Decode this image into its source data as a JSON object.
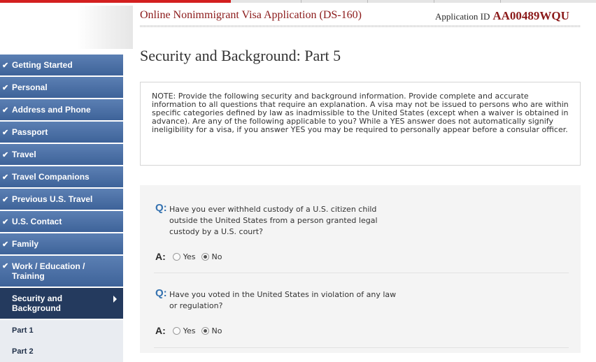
{
  "header": {
    "app_title": "Online Nonimmigrant Visa Application (DS-160)",
    "app_id_label": "Application ID",
    "app_id_value": "AA00489WQU"
  },
  "page": {
    "title": "Security and Background: Part 5"
  },
  "sidebar": {
    "items": [
      {
        "label": "Getting Started",
        "check": "✔"
      },
      {
        "label": "Personal",
        "check": "✔"
      },
      {
        "label": "Address and Phone",
        "check": "✔"
      },
      {
        "label": "Passport",
        "check": "✔"
      },
      {
        "label": "Travel",
        "check": "✔"
      },
      {
        "label": "Travel Companions",
        "check": "✔"
      },
      {
        "label": "Previous U.S. Travel",
        "check": "✔"
      },
      {
        "label": "U.S. Contact",
        "check": "✔"
      },
      {
        "label": "Family",
        "check": "✔"
      },
      {
        "label_line1": "Work / Education /",
        "label_line2": "Training",
        "check": "✔"
      }
    ],
    "active": {
      "line1": "Security and",
      "line2": "Background"
    },
    "subitems": [
      {
        "label": "Part 1"
      },
      {
        "label": "Part 2"
      }
    ]
  },
  "note": {
    "text": "NOTE: Provide the following security and background information. Provide complete and accurate information to all questions that require an explanation. A visa may not be issued to persons who are within specific categories defined by law as inadmissible to the United States (except when a waiver is obtained in advance). Are any of the following applicable to you? While a YES answer does not automatically signify ineligibility for a visa, if you answer YES you may be required to personally appear before a consular officer."
  },
  "questions": [
    {
      "q_label": "Q:",
      "text_lines": [
        "Have you ever withheld custody of a U.S. citizen child",
        "outside the United States from a person granted legal",
        "custody by a U.S. court?"
      ],
      "a_label": "A:",
      "yes_label": "Yes",
      "no_label": "No",
      "selected": "No"
    },
    {
      "q_label": "Q:",
      "text_lines": [
        "Have you voted in the United States in violation of any law",
        "or regulation?"
      ],
      "a_label": "A:",
      "yes_label": "Yes",
      "no_label": "No",
      "selected": "No"
    }
  ]
}
